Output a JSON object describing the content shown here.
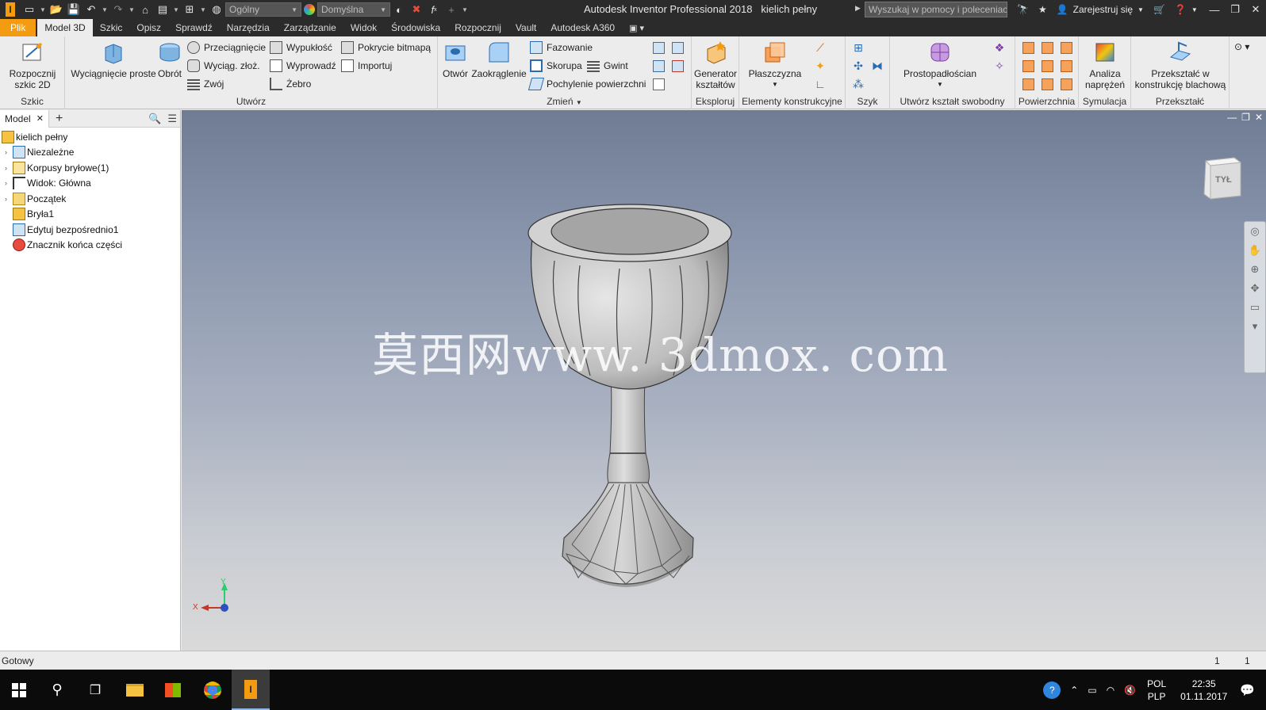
{
  "titlebar": {
    "app_title": "Autodesk Inventor Professional 2018",
    "doc_title": "kielich pełny",
    "material_select": "Ogólny",
    "appearance_select": "Domyślna",
    "search_placeholder": "Wyszukaj w pomocy i poleceniach",
    "sign_in": "Zarejestruj się"
  },
  "tabs": [
    "Plik",
    "Model 3D",
    "Szkic",
    "Opisz",
    "Sprawdź",
    "Narzędzia",
    "Zarządzanie",
    "Widok",
    "Środowiska",
    "Rozpocznij",
    "Vault",
    "Autodesk A360"
  ],
  "ribbon": {
    "szkic": {
      "title": "Szkic",
      "start_sketch": "Rozpocznij szkic 2D"
    },
    "utworz": {
      "title": "Utwórz",
      "extrude": "Wyciągnięcie proste",
      "revolve": "Obrót",
      "loft": "Przeciągnięcie",
      "sweep": "Wyciąg. złoż.",
      "coil": "Zwój",
      "emboss": "Wypukłość",
      "derive": "Wyprowadź",
      "rib": "Żebro",
      "decal": "Pokrycie bitmapą",
      "import": "Importuj"
    },
    "zmien": {
      "title": "Zmień",
      "hole": "Otwór",
      "fillet": "Zaokrąglenie",
      "chamfer": "Fazowanie",
      "shell": "Skorupa",
      "thread": "Gwint",
      "draft": "Pochylenie powierzchni"
    },
    "eksploruj": {
      "title": "Eksploruj",
      "shape_gen": "Generator kształtów"
    },
    "elementy": {
      "title": "Elementy konstrukcyjne",
      "plane": "Płaszczyzna"
    },
    "szyk": {
      "title": "Szyk"
    },
    "freeform": {
      "title": "Utwórz kształt swobodny",
      "box": "Prostopadłościan"
    },
    "powierzchnia": {
      "title": "Powierzchnia"
    },
    "symulacja": {
      "title": "Symulacja",
      "stress": "Analiza naprężeń"
    },
    "przeksztalc": {
      "title": "Przekształć",
      "sheet_metal": "Przekształć w konstrukcję blachową"
    }
  },
  "browser": {
    "tab": "Model",
    "items": [
      {
        "label": "kielich pełny",
        "level": 0,
        "icon": "part-icon"
      },
      {
        "label": "Niezależne",
        "level": 1,
        "icon": "relationships-icon"
      },
      {
        "label": "Korpusy bryłowe(1)",
        "level": 1,
        "icon": "solid-bodies-icon"
      },
      {
        "label": "Widok: Główna",
        "level": 1,
        "icon": "view-icon"
      },
      {
        "label": "Początek",
        "level": 1,
        "icon": "folder-icon"
      },
      {
        "label": "Bryła1",
        "level": 1,
        "icon": "solid-icon"
      },
      {
        "label": "Edytuj bezpośrednio1",
        "level": 1,
        "icon": "direct-edit-icon"
      },
      {
        "label": "Znacznik końca części",
        "level": 1,
        "icon": "end-of-part-icon"
      }
    ]
  },
  "viewport": {
    "watermark": "莫西网www. 3dmox. com",
    "viewcube_label": "TYŁ",
    "axis_x": "X",
    "axis_y": "Y"
  },
  "status": {
    "text": "Gotowy",
    "count1": "1",
    "count2": "1"
  },
  "taskbar": {
    "lang1": "POL",
    "lang2": "PLP",
    "time": "22:35",
    "date": "01.11.2017"
  },
  "colors": {
    "accent": "#f39c12",
    "titlebar_bg": "#2b2b2b",
    "ribbon_bg": "#ececec"
  }
}
